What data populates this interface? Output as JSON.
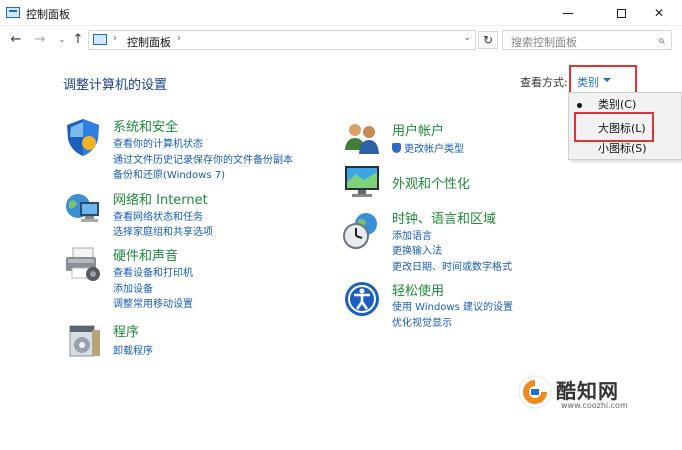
{
  "window": {
    "title": "控制面板",
    "controls": {
      "minimize": "minimize-icon",
      "maximize": "maximize-icon",
      "close": "✕"
    }
  },
  "navigation": {
    "back": "←",
    "forward": "→",
    "recent": "⌄",
    "up": "↑",
    "address": "控制面板",
    "separator": "›",
    "refresh": "↻",
    "search_placeholder": "搜索控制面板"
  },
  "header": {
    "title": "调整计算机的设置",
    "view_by_label": "查看方式:",
    "view_by_value": "类别"
  },
  "view_menu": {
    "items": [
      {
        "label": "类别(C)",
        "selected": true
      },
      {
        "label": "大图标(L)",
        "selected": false
      },
      {
        "label": "小图标(S)",
        "selected": false
      }
    ]
  },
  "categories": {
    "left": [
      {
        "title": "系统和安全",
        "icon": "shield-icon",
        "links": [
          "查看你的计算机状态",
          "通过文件历史记录保存你的文件备份副本",
          "备份和还原(Windows 7)"
        ]
      },
      {
        "title": "网络和 Internet",
        "icon": "network-globe-icon",
        "links": [
          "查看网络状态和任务",
          "选择家庭组和共享选项"
        ]
      },
      {
        "title": "硬件和声音",
        "icon": "printer-icon",
        "links": [
          "查看设备和打印机",
          "添加设备",
          "调整常用移动设置"
        ]
      },
      {
        "title": "程序",
        "icon": "programs-icon",
        "links": [
          "卸载程序"
        ]
      }
    ],
    "right": [
      {
        "title": "用户帐户",
        "icon": "users-icon",
        "links": [
          "更改帐户类型"
        ]
      },
      {
        "title": "外观和个性化",
        "icon": "monitor-icon",
        "links": []
      },
      {
        "title": "时钟、语言和区域",
        "icon": "clock-globe-icon",
        "links": [
          "添加语言",
          "更换输入法",
          "更改日期、时间或数字格式"
        ]
      },
      {
        "title": "轻松使用",
        "icon": "accessibility-icon",
        "links": [
          "使用 Windows 建议的设置",
          "优化视觉显示"
        ]
      }
    ]
  },
  "watermark": {
    "name": "酷知网",
    "url": "www.coozhi.com"
  },
  "colors": {
    "category_title": "#1f8a3a",
    "link": "#1a5db8",
    "highlight_box": "#e23232",
    "page_title": "#1e3f8a"
  }
}
